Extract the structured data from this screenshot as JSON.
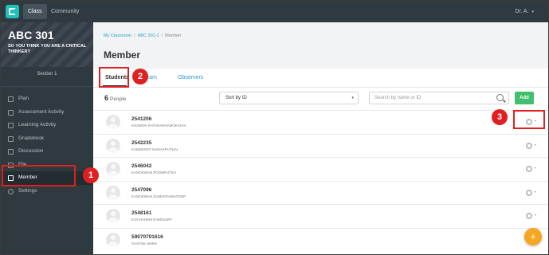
{
  "topbar": {
    "nav": [
      {
        "label": "Class"
      },
      {
        "label": "Community"
      }
    ],
    "user": "Dr. A.",
    "user_caret": "▾"
  },
  "sidebar": {
    "course_code": "ABC 301",
    "course_subtitle": "SO YOU THINK YOU ARE A CRITICAL THINKER?",
    "section": "Section 1",
    "items": [
      {
        "label": "Plan",
        "icon": "plan-icon"
      },
      {
        "label": "Assessment Activity",
        "icon": "assessment-icon"
      },
      {
        "label": "Learning Activity",
        "icon": "learning-icon"
      },
      {
        "label": "Gradebook",
        "icon": "gradebook-icon"
      },
      {
        "label": "Discussion",
        "icon": "discussion-icon"
      },
      {
        "label": "File",
        "icon": "file-icon"
      },
      {
        "label": "Member",
        "icon": "member-icon"
      },
      {
        "label": "Settings",
        "icon": "settings-icon"
      }
    ]
  },
  "breadcrumb": {
    "items": [
      "My Classroom",
      "ABC 301-1",
      "Member"
    ],
    "sep": "/"
  },
  "page": {
    "title": "Member"
  },
  "tabs": [
    {
      "label": "Students"
    },
    {
      "label": "g Team"
    },
    {
      "label": "Observers"
    }
  ],
  "toolbar": {
    "count": "6",
    "count_label": "People",
    "sort_value": "Sort by ID",
    "sort_caret": "▾",
    "search_placeholder": "Search by name or ID",
    "add_label": "Add"
  },
  "members": [
    {
      "id": "2541206",
      "name": "KHAMOK RATANAKHAMOKCHAI"
    },
    {
      "id": "2542235",
      "name": "KAMOKRAT NAKHAPUTHAI"
    },
    {
      "id": "2546042",
      "name": "KANOKWAN POOMPUTEA"
    },
    {
      "id": "2547096",
      "name": "KANOKWAN SUMANTAWATOOP"
    },
    {
      "id": "2548161",
      "name": "KOCHAHEM KAMOLWIT"
    },
    {
      "id": "59070701616",
      "name": "Somchai Jaidee"
    }
  ],
  "row_caret": "▾",
  "fab": {
    "label": "+"
  },
  "annotations": [
    {
      "number": "1"
    },
    {
      "number": "2"
    },
    {
      "number": "3"
    }
  ],
  "colors": {
    "accent": "#2a9ec9",
    "add_button": "#3fbf6f",
    "highlight": "#e02020",
    "fab": "#f5a623"
  }
}
